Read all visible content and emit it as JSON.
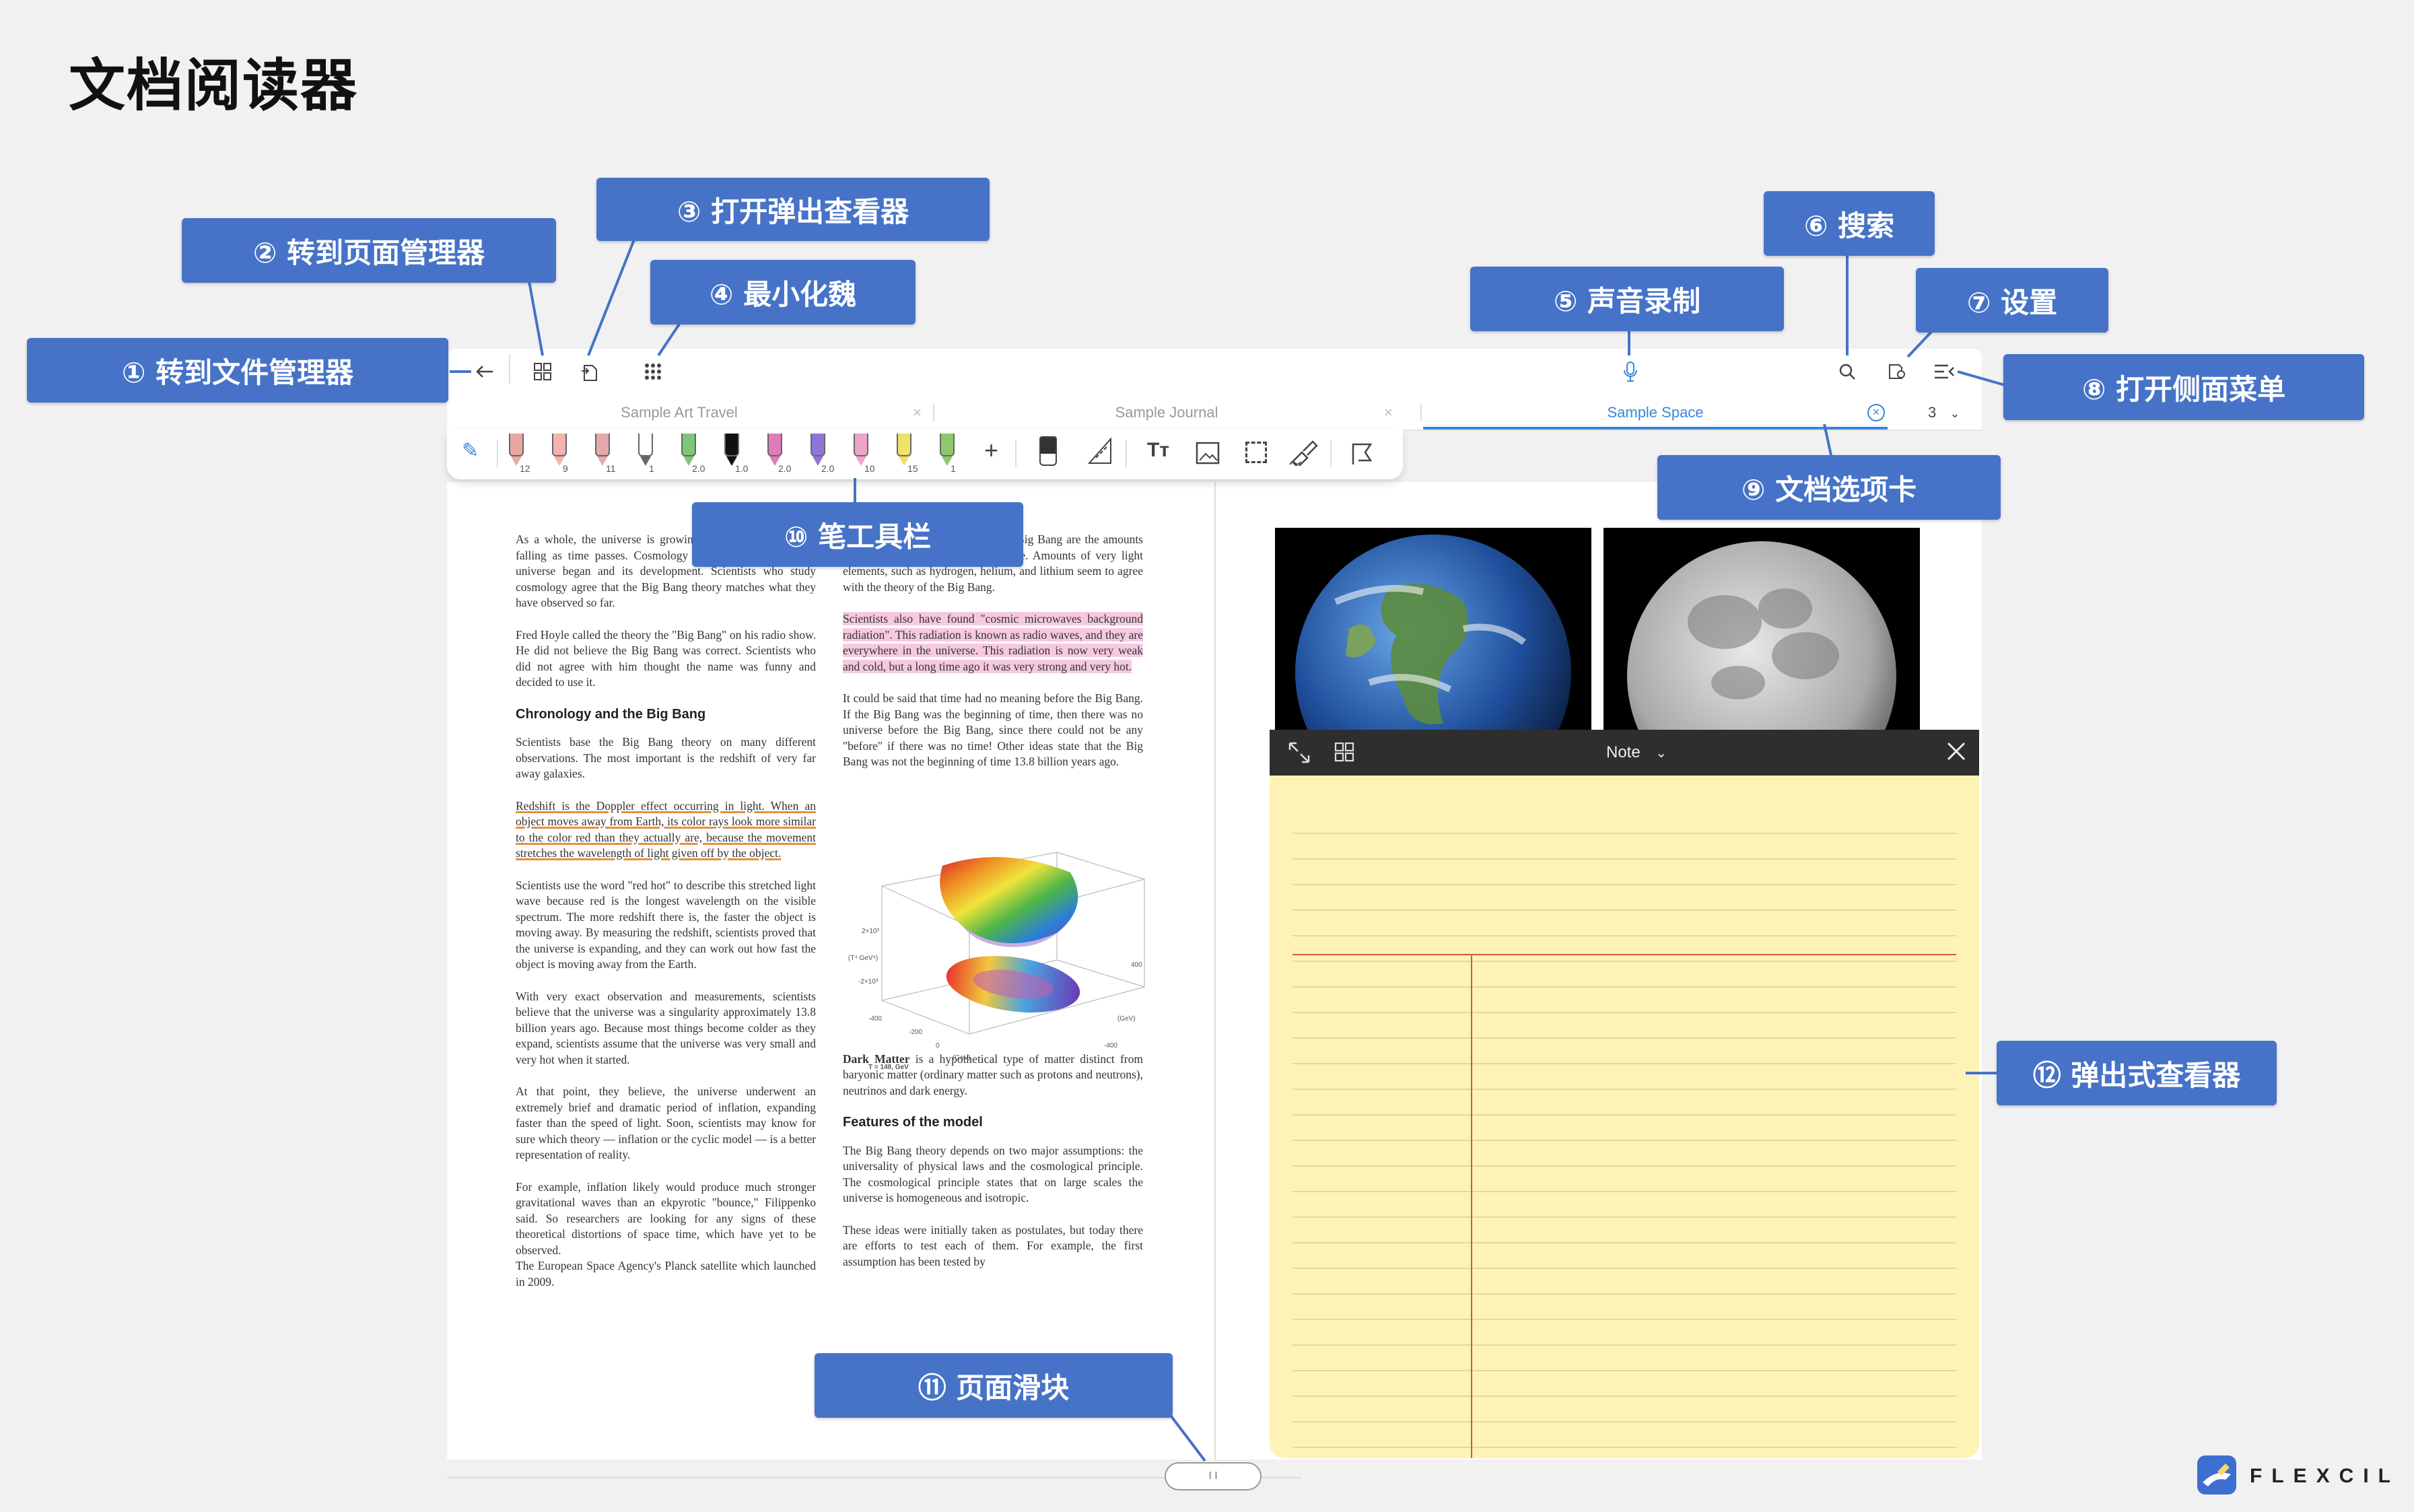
{
  "page_title": "文档阅读器",
  "toolbar_top": {
    "back": "back-arrow-icon",
    "grid": "grid-icon",
    "popout": "popout-icon",
    "dots": "dots-icon",
    "mic": "microphone-icon",
    "search": "search-icon",
    "settings": "settings-icon",
    "menu": "side-menu-icon"
  },
  "tabs": [
    {
      "label": "Sample Art Travel",
      "active": false
    },
    {
      "label": "Sample Journal",
      "active": false
    },
    {
      "label": "Sample Space",
      "active": true
    }
  ],
  "tab_count": "3",
  "pen_tools": [
    {
      "num": "12",
      "color": "#e9a7a4"
    },
    {
      "num": "9",
      "color": "#f3b3b1"
    },
    {
      "num": "11",
      "color": "#e6a9a9"
    },
    {
      "num": "1",
      "color": "#ffffff"
    },
    {
      "num": "2.0",
      "color": "#7dc67a"
    },
    {
      "num": "1.0",
      "color": "#111111"
    },
    {
      "num": "2.0",
      "color": "#e07ab9"
    },
    {
      "num": "2.0",
      "color": "#8e76d8"
    },
    {
      "num": "10",
      "color": "#f1a2c8"
    },
    {
      "num": "15",
      "color": "#eee26b"
    },
    {
      "num": "1",
      "color": "#8ec86a"
    }
  ],
  "left_column": {
    "p1": "As a whole, the universe is growing and the temperature is falling as time passes. Cosmology is the study of how the universe began and its development. Scientists who study cosmology agree that the Big Bang theory matches what they have observed so far.",
    "p2": "Fred Hoyle called the theory the \"Big Bang\" on his radio show. He did not believe the Big Bang was correct. Scientists who did not agree with him thought the name was funny and decided to use it.",
    "h1": "Chronology and the Big Bang",
    "p3": "Scientists base the Big Bang theory on many different observations. The most important is the redshift of very far away galaxies.",
    "p4": "Redshift is the Doppler effect occurring in light. When an object moves away from Earth, its color rays look more similar to the color red than they actually are, because the movement stretches the wavelength of light given off by the object.",
    "p5": "Scientists use the word \"red hot\" to describe this stretched light wave because red is the longest wavelength on the visible spectrum. The more redshift there is, the faster the object is moving away. By measuring the redshift, scientists proved that the universe is expanding, and they can work out how fast the object is moving away from the Earth.",
    "p6": "With very exact observation and measurements, scientists believe that the universe was a singularity approximately 13.8 billion years ago. Because most things become colder as they expand, scientists assume that the universe was very small and very hot when it started.",
    "p7": "At that point, they believe, the universe underwent an extremely brief and dramatic period of inflation, expanding faster than the speed of light. Soon, scientists may know for sure which theory — inflation or the cyclic model — is a better representation of reality.",
    "p8": "For example, inflation likely would produce much stronger gravitational waves than an ekpyrotic \"bounce,\" Filippenko said. So researchers are looking for any signs of these theoretical distortions of space time, which have yet to be observed.",
    "p9": "The European Space Agency's Planck satellite which launched in 2009."
  },
  "right_column": {
    "p1": "Other observations that support the Big Bang are the amounts of chemical elements in the universe. Amounts of very light elements, such as hydrogen, helium, and lithium seem to agree with the theory of the Big Bang.",
    "p2": "Scientists also have found \"cosmic microwaves background radiation\". This radiation is known as radio waves, and they are everywhere in the universe. This radiation is now very weak and cold, but a long time ago it was very strong and very hot.",
    "p3": "It could be said that time had no meaning before the Big Bang. If the Big Bang was the beginning of time, then there was no universe before the Big Bang, since there could not be any \"before\" if there was no time! Other ideas state that the Big Bang was not the beginning of time 13.8 billion years ago.",
    "p4_bold": "Dark Matter",
    "p4": " is a hypothetical type of matter distinct from baryonic matter (ordinary matter such as protons and neutrons), neutrinos and dark energy.",
    "h1": "Features of the model",
    "p5": "The Big Bang theory depends on two major assumptions: the universality of physical laws and the cosmological principle. The cosmological principle states that on large scales the universe is homogeneous and isotropic.",
    "p6": "These ideas were initially taken as postulates, but today there are efforts to test each of them. For example, the first assumption has been tested by"
  },
  "plot_labels": {
    "t": "T = 148, GeV",
    "y1": "2×10³",
    "y2": "(T⁴ GeV⁴)",
    "y3": "-2×10³",
    "x1": "-400",
    "x2": "-200",
    "x3": "0",
    "x4": "400",
    "z1": "400",
    "z2": "0",
    "z3": "-200",
    "z4": "-400",
    "xu": "(GeV)",
    "zu": "(GeV)"
  },
  "note": {
    "title": "Note",
    "expand": "expand-icon",
    "grid": "grid-icon",
    "close": "close-icon"
  },
  "slider_label": "I I",
  "brand": "FLEXCIL",
  "callouts": {
    "c1": "① 转到文件管理器",
    "c2": "② 转到页面管理器",
    "c3": "③ 打开弹出查看器",
    "c4": "④ 最小化魏",
    "c5": "⑤ 声音录制",
    "c6": "⑥ 搜索",
    "c7": "⑦ 设置",
    "c8": "⑧ 打开侧面菜单",
    "c9": "⑨ 文档选项卡",
    "c10": "⑩ 笔工具栏",
    "c11": "⑪ 页面滑块",
    "c12": "⑫ 弹出式查看器"
  },
  "colors": {
    "callout": "#4673c7",
    "accent": "#3a86d8",
    "note_bg": "#fdf3b5",
    "note_margin": "#d9534f"
  }
}
